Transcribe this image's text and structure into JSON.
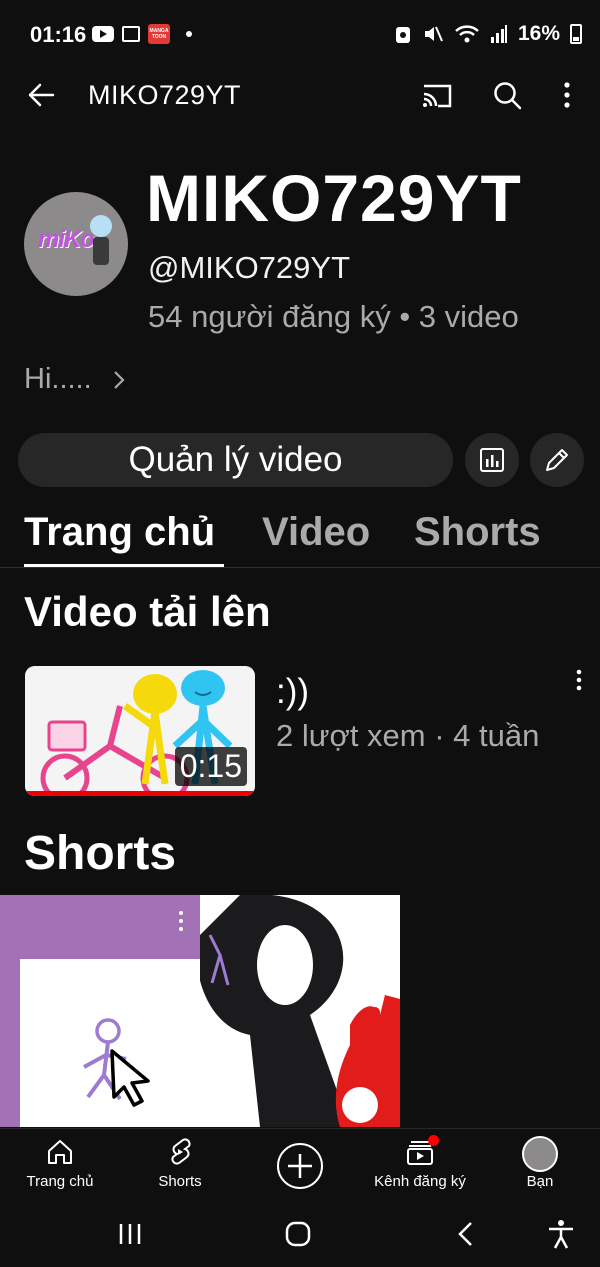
{
  "status_bar": {
    "time": "01:16",
    "battery": "16%",
    "icons": [
      "youtube-icon",
      "gallery-icon",
      "mangatoon-icon",
      "dot-icon",
      "app-notification-icon",
      "mute-icon",
      "wifi-icon",
      "signal-icon",
      "battery-icon"
    ],
    "mangatoon_text": "MANGA TOON"
  },
  "app_bar": {
    "title": "MIKO729YT",
    "icons": [
      "back-arrow-icon",
      "cast-icon",
      "search-icon",
      "more-vert-icon"
    ]
  },
  "channel": {
    "name": "MIKO729YT",
    "handle": "@MIKO729YT",
    "stats": "54 người đăng ký • 3 video",
    "description": "Hi.....",
    "avatar_text": "miKo"
  },
  "actions": {
    "manage_label": "Quản lý video",
    "icons": [
      "analytics-icon",
      "edit-pencil-icon"
    ]
  },
  "tabs": [
    {
      "label": "Trang chủ",
      "active": true
    },
    {
      "label": "Video",
      "active": false
    },
    {
      "label": "Shorts",
      "active": false
    }
  ],
  "uploads": {
    "section_title": "Video tải lên",
    "videos": [
      {
        "title": ":))",
        "meta": "2 lượt xem · 4 tuần",
        "duration": "0:15"
      }
    ]
  },
  "shorts": {
    "section_title": "Shorts"
  },
  "bottom_nav": [
    {
      "label": "Trang chủ",
      "icon": "home-icon"
    },
    {
      "label": "Shorts",
      "icon": "shorts-icon"
    },
    {
      "label": "",
      "icon": "create-plus-icon"
    },
    {
      "label": "Kênh đăng ký",
      "icon": "subscriptions-icon"
    },
    {
      "label": "Bạn",
      "icon": "user-avatar"
    }
  ],
  "system_nav": [
    "recents-icon",
    "home-circle-icon",
    "back-chevron-icon",
    "accessibility-icon"
  ],
  "colors": {
    "background": "#0f0f0f",
    "chip": "#272727",
    "secondary_text": "#aaaaaa",
    "accent_red": "#ff0000",
    "short_purple": "#a371b5"
  }
}
